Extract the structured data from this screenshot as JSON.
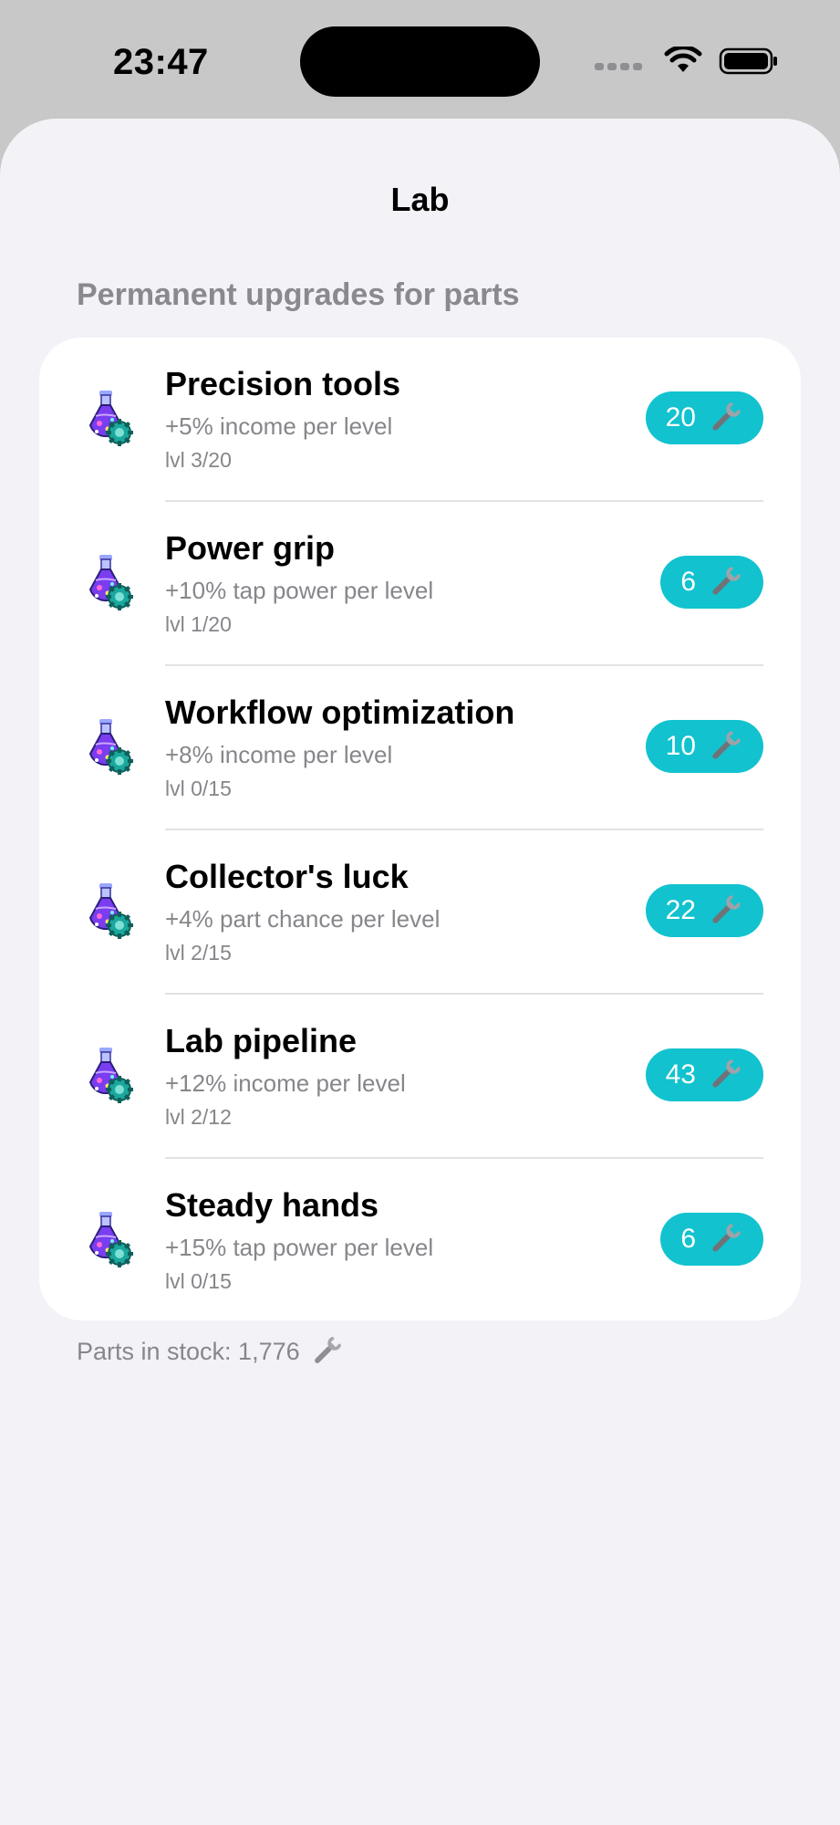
{
  "status_bar": {
    "time": "23:47"
  },
  "sheet": {
    "title": "Lab",
    "section_header": "Permanent upgrades for parts",
    "upgrades": [
      {
        "title": "Precision tools",
        "description": "+5% income per level",
        "level": "lvl 3/20",
        "price": "20"
      },
      {
        "title": "Power grip",
        "description": "+10% tap power per level",
        "level": "lvl 1/20",
        "price": "6"
      },
      {
        "title": "Workflow optimization",
        "description": "+8% income per level",
        "level": "lvl 0/15",
        "price": "10"
      },
      {
        "title": "Collector's luck",
        "description": "+4% part chance per level",
        "level": "lvl 2/15",
        "price": "22"
      },
      {
        "title": "Lab pipeline",
        "description": "+12% income per level",
        "level": "lvl 2/12",
        "price": "43"
      },
      {
        "title": "Steady hands",
        "description": "+15% tap power per level",
        "level": "lvl 0/15",
        "price": "6"
      }
    ],
    "footer": "Parts in stock: 1,776"
  },
  "icons": {
    "upgrade": "potion-flask-icon",
    "currency": "wrench-icon"
  },
  "colors": {
    "accent": "#12c2cf",
    "background": "#f2f2f7",
    "secondary_text": "#86868b"
  }
}
